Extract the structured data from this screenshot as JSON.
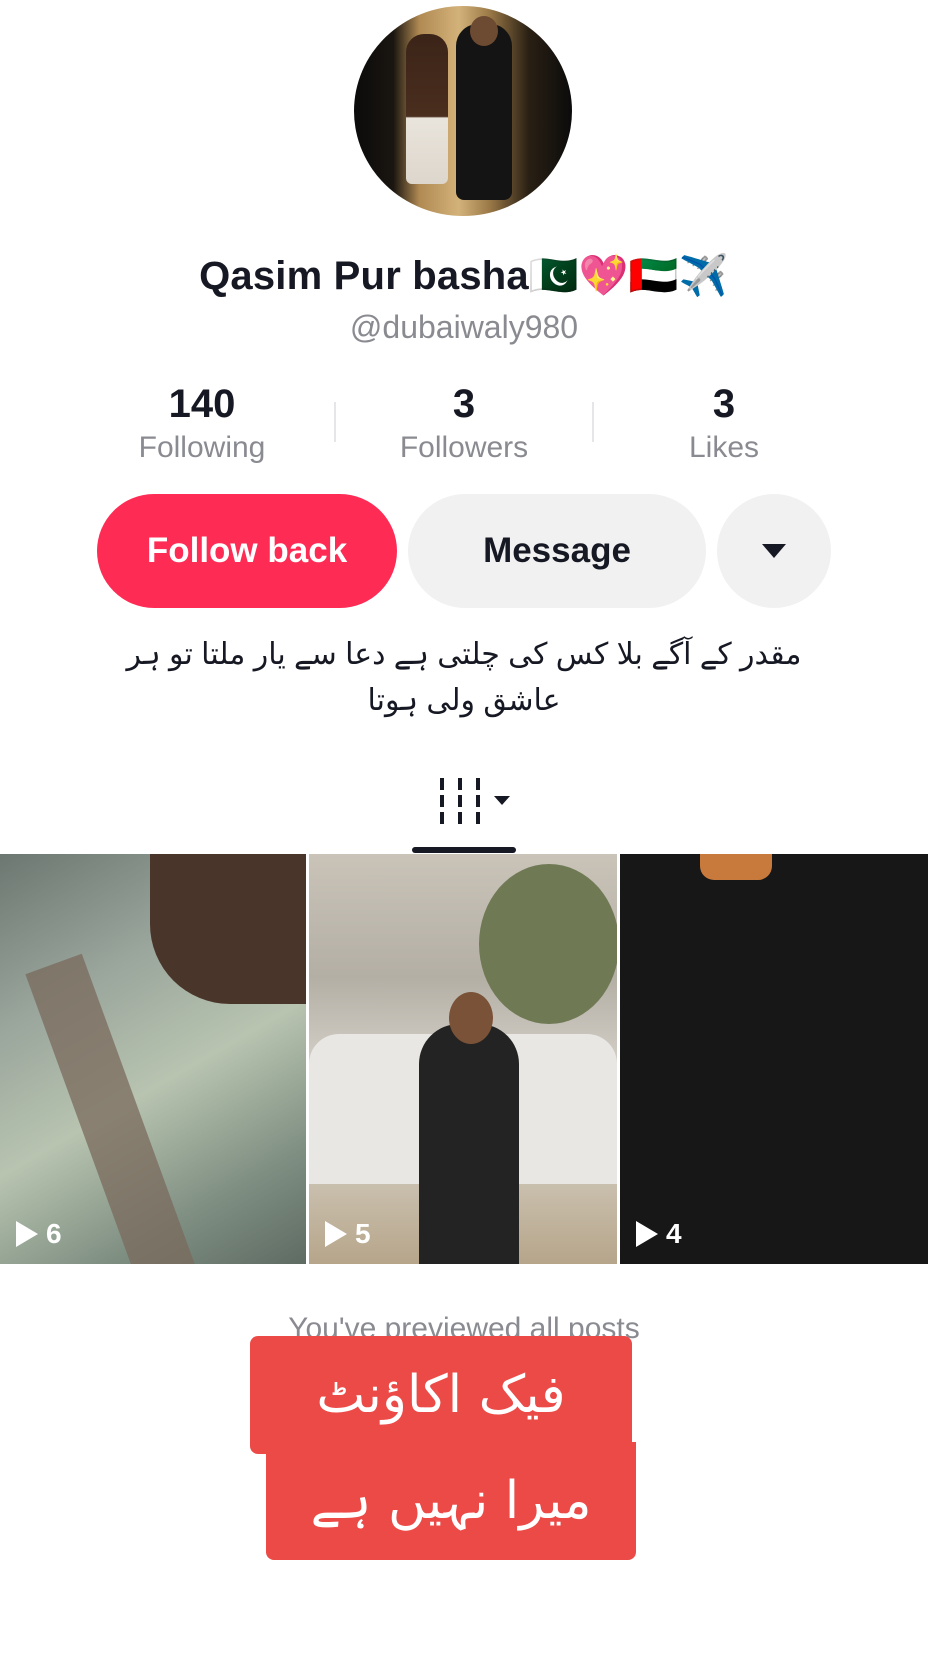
{
  "profile": {
    "display_name": "Qasim Pur basha🇵🇰💖🇦🇪✈️",
    "handle": "@dubaiwaly980"
  },
  "stats": {
    "following": {
      "value": "140",
      "label": "Following"
    },
    "followers": {
      "value": "3",
      "label": "Followers"
    },
    "likes": {
      "value": "3",
      "label": "Likes"
    }
  },
  "actions": {
    "follow_back_label": "Follow back",
    "message_label": "Message",
    "more_icon": "caret-down-icon"
  },
  "bio": "مقدر کے آگے بلا کس کی چلتی ہے دعا سے یار ملتا تو ہر عاشق ولی ہوتا",
  "tabs": {
    "videos_icon": "grid-icon"
  },
  "videos": [
    {
      "views": "6"
    },
    {
      "views": "5"
    },
    {
      "views": "4"
    }
  ],
  "footer_note": "You've previewed all posts",
  "overlay": {
    "line1": "فیک اکاؤنٹ",
    "line2": "میرا نہیں ہے"
  },
  "colors": {
    "accent": "#fe2c55",
    "overlay": "#ec4a47",
    "secondary_text": "#8a8b91"
  }
}
